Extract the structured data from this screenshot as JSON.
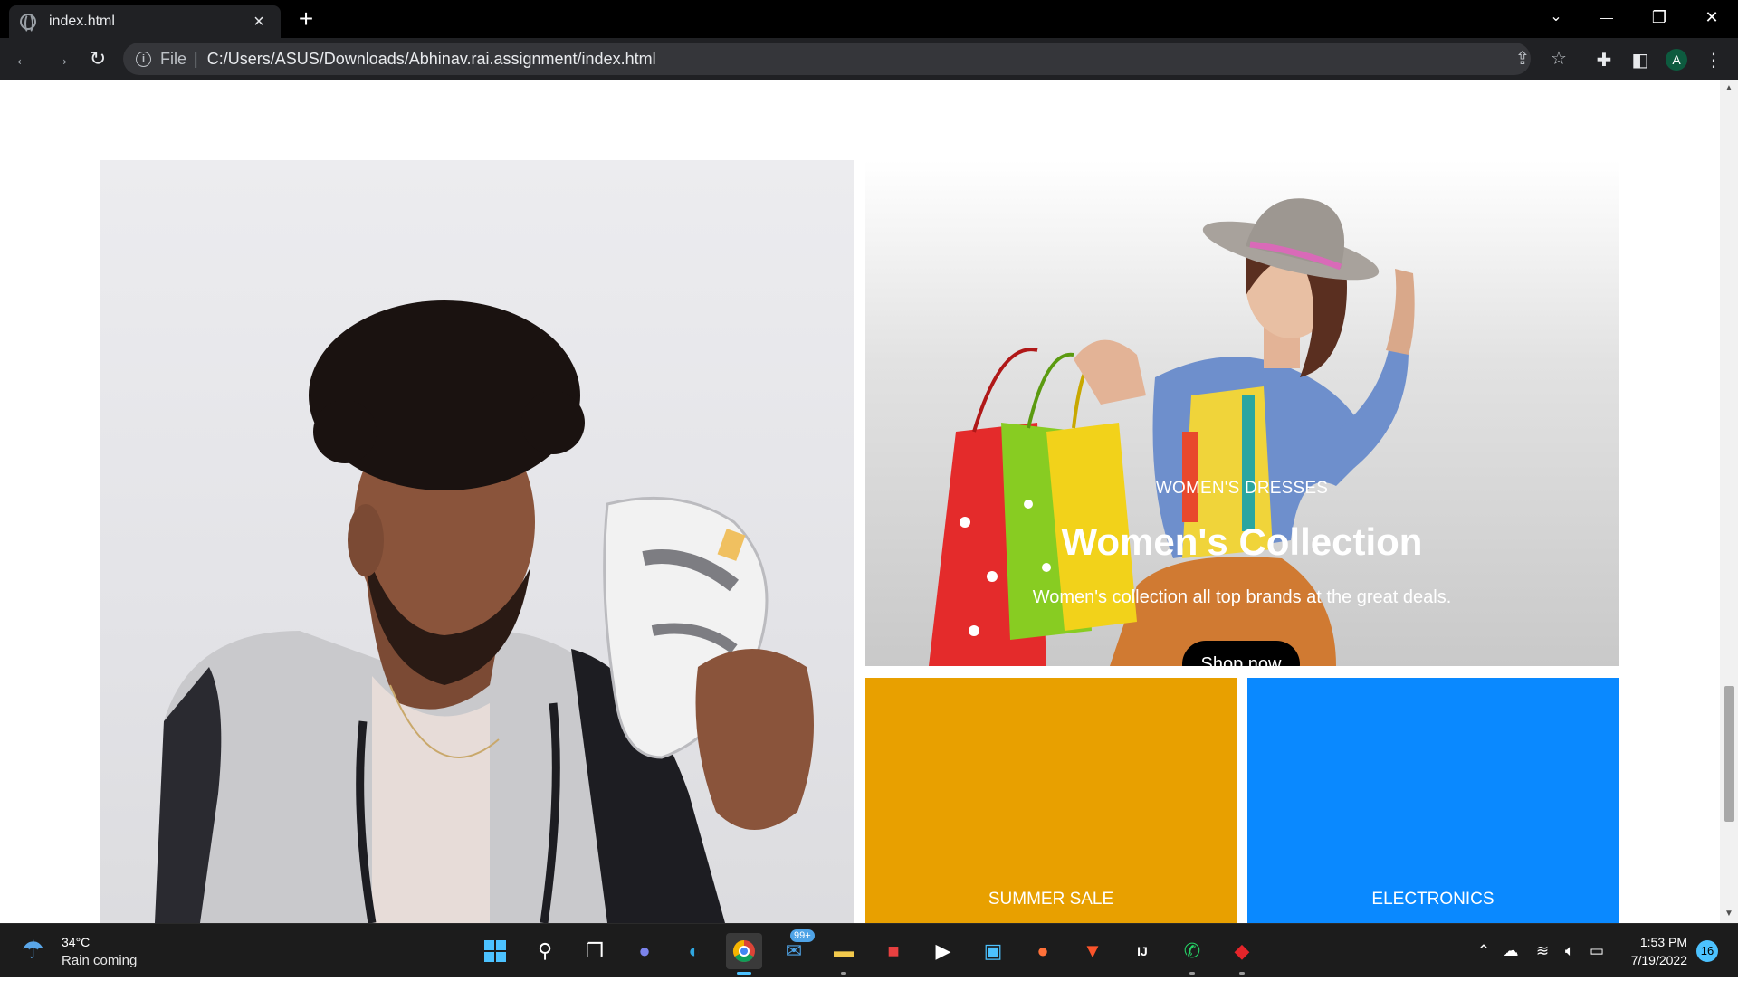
{
  "browser": {
    "tab_title": "index.html",
    "tab_close": "×",
    "new_tab": "+",
    "window_controls": {
      "tabsearch": "⌄",
      "minimize": "—",
      "restore": "❐",
      "close": "✕"
    },
    "nav": {
      "back": "←",
      "forward": "→",
      "reload": "↻"
    },
    "address": {
      "scheme_label": "File",
      "separator": "|",
      "url": "C:/Users/ASUS/Downloads/Abhinav.rai.assignment/index.html"
    },
    "profile_initial": "A"
  },
  "page": {
    "womens": {
      "subtitle": "WOMEN'S DRESSES",
      "title": "Women's Collection",
      "description": "Women's collection all top brands at the great deals.",
      "button": "Shop now"
    },
    "tiles": [
      {
        "label": "SUMMER SALE",
        "color": "#e8a000"
      },
      {
        "label": "ELECTRONICS",
        "color": "#0a89ff"
      }
    ]
  },
  "taskbar": {
    "weather": {
      "temp": "34°C",
      "status": "Rain coming"
    },
    "mail_badge": "99+",
    "clock": {
      "time": "1:53 PM",
      "date": "7/19/2022"
    },
    "notifications": "16"
  }
}
